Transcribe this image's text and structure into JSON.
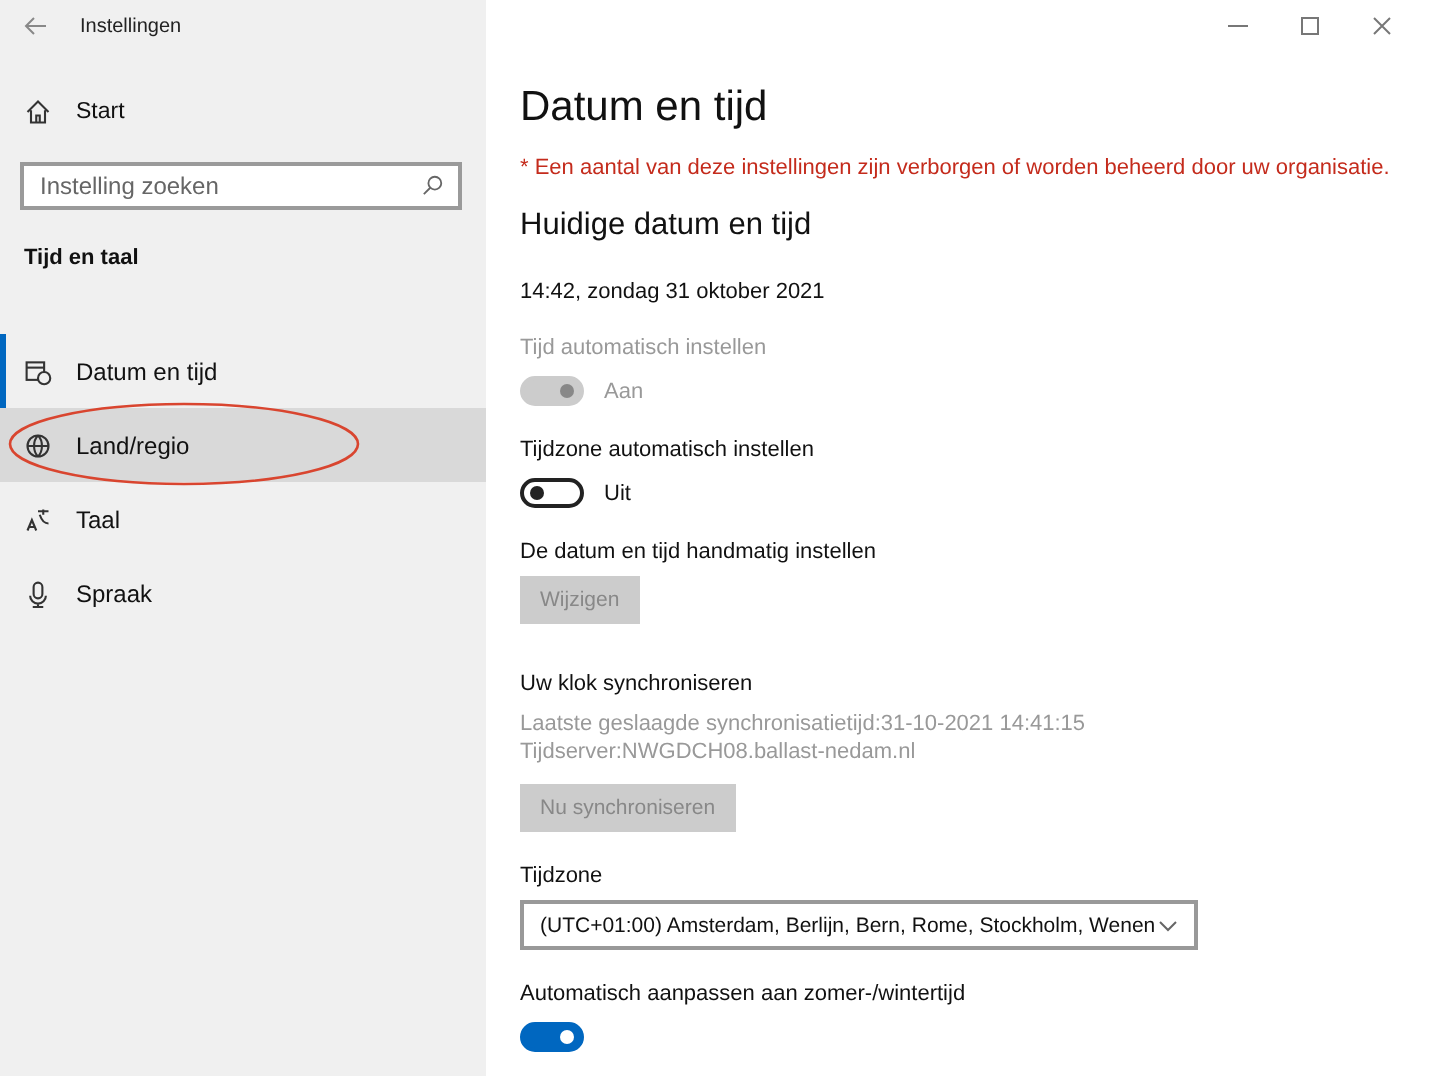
{
  "window": {
    "title": "Instellingen"
  },
  "sidebar": {
    "home": "Start",
    "search": {
      "placeholder": "Instelling zoeken"
    },
    "section": "Tijd en taal",
    "items": [
      {
        "label": "Datum en tijd",
        "selected": true,
        "hovered": false,
        "circled": false
      },
      {
        "label": "Land/regio",
        "selected": false,
        "hovered": true,
        "circled": true
      },
      {
        "label": "Taal",
        "selected": false,
        "hovered": false,
        "circled": false
      },
      {
        "label": "Spraak",
        "selected": false,
        "hovered": false,
        "circled": false
      }
    ]
  },
  "page": {
    "title": "Datum en tijd",
    "notice": "* Een aantal van deze instellingen zijn verborgen of worden beheerd door uw organisatie.",
    "section": "Huidige datum en tijd",
    "current": "14:42, zondag 31 oktober 2021",
    "settings": [
      {
        "kind": "toggle",
        "label": "Tijd automatisch instellen",
        "on": true,
        "disabled": true,
        "state_text": "Aan"
      },
      {
        "kind": "toggle",
        "label": "Tijdzone automatisch instellen",
        "on": false,
        "disabled": false,
        "state_text": "Uit"
      },
      {
        "kind": "button",
        "label": "De datum en tijd handmatig instellen",
        "button": "Wijzigen",
        "disabled": true
      },
      {
        "kind": "sync",
        "label": "Uw klok synchroniseren",
        "lines": [
          "Laatste geslaagde synchronisatietijd:31-10-2021 14:41:15",
          "Tijdserver:NWGDCH08.ballast-nedam.nl"
        ],
        "button": "Nu synchroniseren",
        "disabled": true
      },
      {
        "kind": "select",
        "label": "Tijdzone",
        "value": "(UTC+01:00) Amsterdam, Berlijn, Bern, Rome, Stockholm, Wenen"
      },
      {
        "kind": "toggle",
        "label": "Automatisch aanpassen aan zomer-/wintertijd",
        "on": true,
        "disabled": false
      }
    ]
  }
}
